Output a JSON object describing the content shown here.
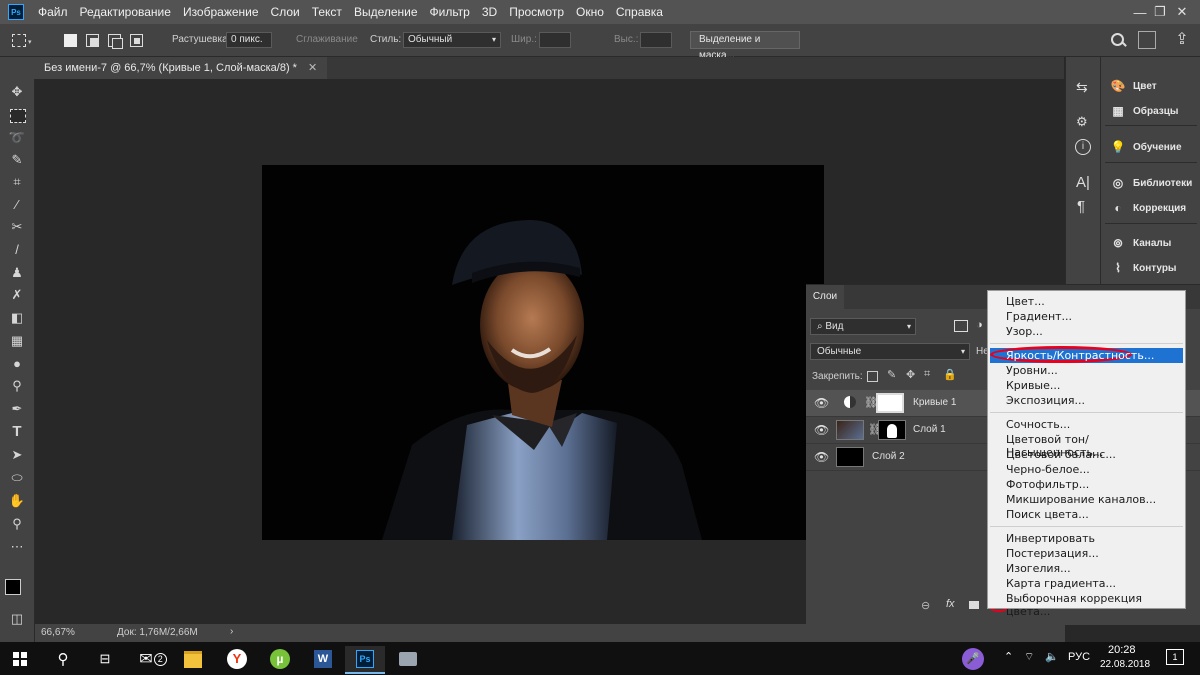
{
  "app": {
    "logo": "Ps"
  },
  "menubar": {
    "items": [
      "Файл",
      "Редактирование",
      "Изображение",
      "Слои",
      "Текст",
      "Выделение",
      "Фильтр",
      "3D",
      "Просмотр",
      "Окно",
      "Справка"
    ],
    "window_controls": {
      "minimize": "—",
      "restore": "❐",
      "close": "✕"
    }
  },
  "options": {
    "feather_label": "Растушевка:",
    "feather_value": "0 пикс.",
    "smooth_label": "Сглаживание",
    "style_label": "Стиль:",
    "style_value": "Обычный",
    "width_label": "Шир.:",
    "height_label": "Выс.:",
    "select_mask_button": "Выделение и маска..."
  },
  "document": {
    "tab_title": "Без имени-7 @ 66,7% (Кривые 1, Слой-маска/8) *",
    "zoom": "66,67%",
    "doc_info": "Док: 1,76M/2,66M"
  },
  "right_panels": {
    "items": [
      "Цвет",
      "Образцы",
      "Обучение",
      "Библиотеки",
      "Коррекция",
      "Каналы",
      "Контуры"
    ]
  },
  "layers_panel": {
    "tab": "Слои",
    "filter": "Вид",
    "blend_mode": "Обычные",
    "opacity_label": "Не",
    "lock_label": "Закрепить:",
    "layers": [
      {
        "name": "Кривые 1"
      },
      {
        "name": "Слой 1"
      },
      {
        "name": "Слой 2"
      }
    ],
    "fx": "fx"
  },
  "context_menu": {
    "group1": [
      "Цвет...",
      "Градиент...",
      "Узор..."
    ],
    "group2": [
      "Яркость/Контрастность...",
      "Уровни...",
      "Кривые...",
      "Экспозиция..."
    ],
    "group3": [
      "Сочность...",
      "Цветовой тон/Насыщенность...",
      "Цветовой баланс...",
      "Черно-белое...",
      "Фотофильтр...",
      "Микширование каналов...",
      "Поиск цвета..."
    ],
    "group4": [
      "Инвертировать",
      "Постеризация...",
      "Изогелия...",
      "Карта градиента...",
      "Выборочная коррекция цвета..."
    ],
    "highlight_color": "#1e73d2",
    "annotation_color": "#e8001c"
  },
  "taskbar": {
    "mail_badge": "2",
    "word": "W",
    "ps": "Ps",
    "lang": "РУС",
    "time": "20:28",
    "date": "22.08.2018",
    "notif_count": "1"
  }
}
